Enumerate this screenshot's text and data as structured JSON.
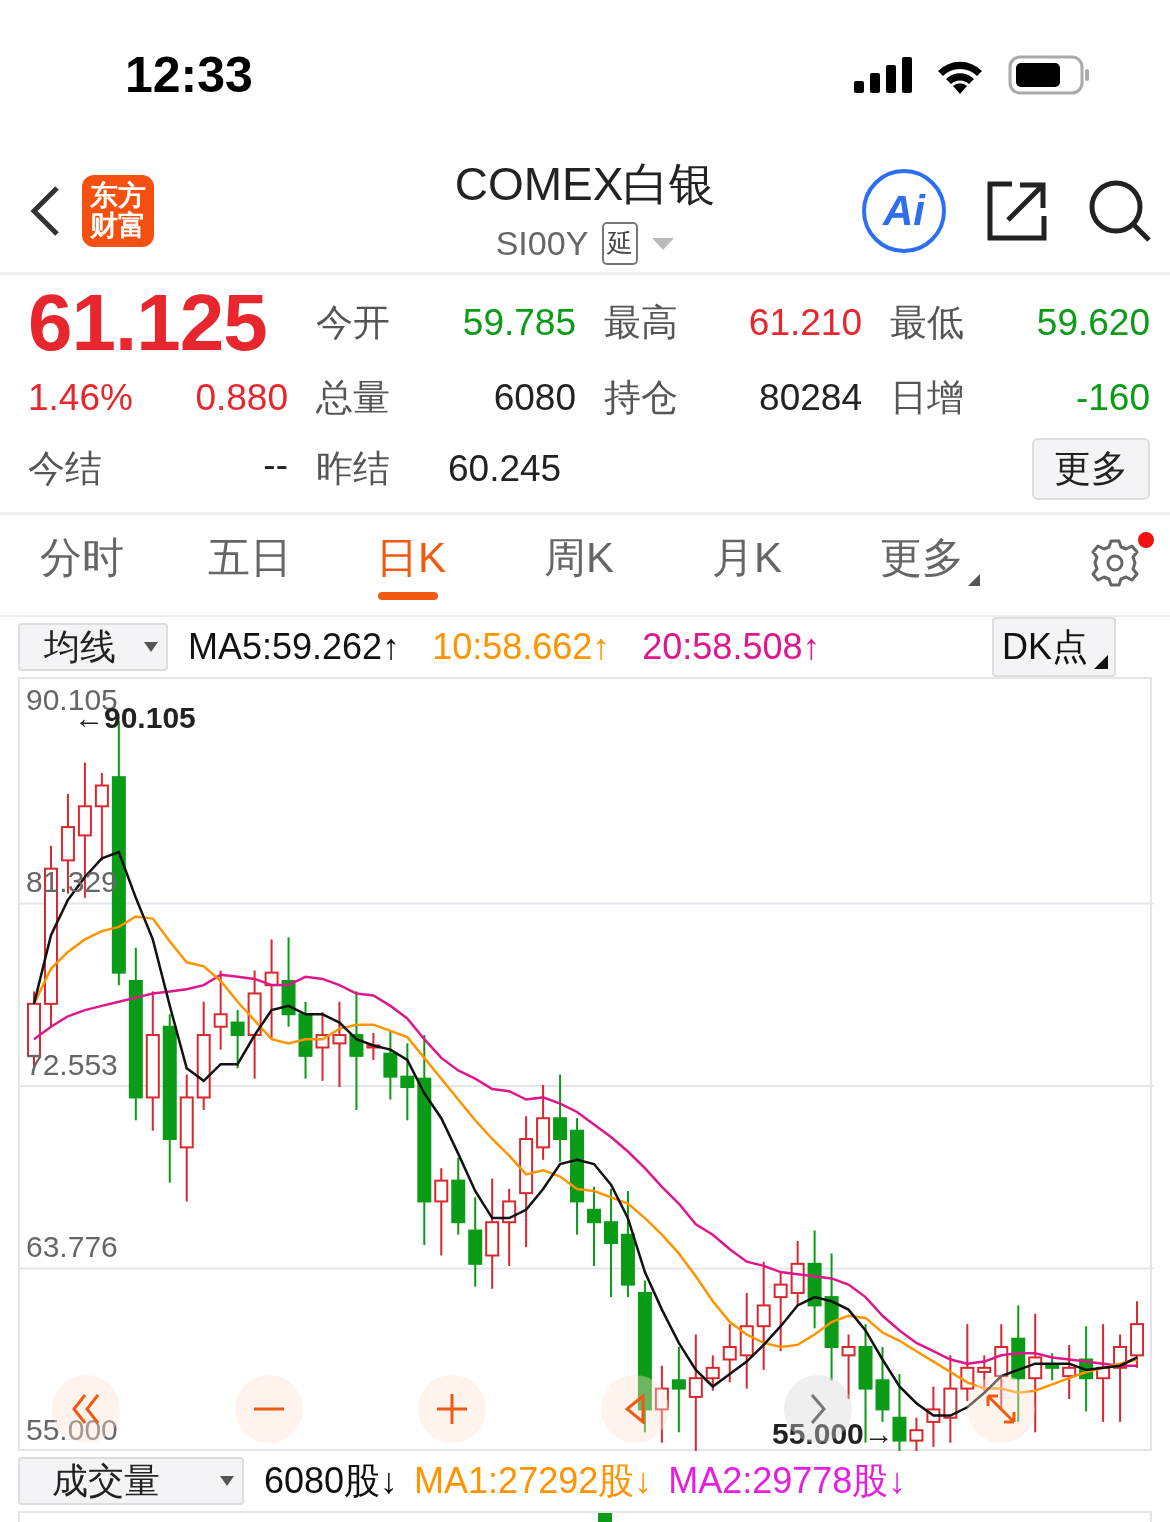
{
  "status_bar": {
    "time": "12:33"
  },
  "header": {
    "logo": "东方财富",
    "title": "COMEX白银",
    "code": "SI00Y",
    "tag": "延",
    "ai": "Ai"
  },
  "quote": {
    "price": "61.125",
    "change_pct": "1.46%",
    "change": "0.880",
    "settle_label": "今结",
    "settle_value": "--",
    "fields": [
      {
        "label": "今开",
        "value": "59.785",
        "color": "#0a9b17"
      },
      {
        "label": "最高",
        "value": "61.210",
        "color": "#e8262d"
      },
      {
        "label": "最低",
        "value": "59.620",
        "color": "#0a9b17"
      },
      {
        "label": "总量",
        "value": "6080",
        "color": "#222222"
      },
      {
        "label": "持仓",
        "value": "80284",
        "color": "#222222"
      },
      {
        "label": "日增",
        "value": "-160",
        "color": "#0a9b17"
      },
      {
        "label": "昨结",
        "value": "60.245",
        "color": "#222222"
      }
    ],
    "more": "更多"
  },
  "tabs": [
    {
      "label": "分时",
      "selected": false,
      "dropdown": false
    },
    {
      "label": "五日",
      "selected": false,
      "dropdown": false
    },
    {
      "label": "日K",
      "selected": true,
      "dropdown": false
    },
    {
      "label": "周K",
      "selected": false,
      "dropdown": false
    },
    {
      "label": "月K",
      "selected": false,
      "dropdown": false
    },
    {
      "label": "更多",
      "selected": false,
      "dropdown": true
    }
  ],
  "settings_badge": true,
  "ma_bar": {
    "selector": "均线",
    "items": [
      {
        "text": "MA5:59.262↑",
        "color": "#111111"
      },
      {
        "text": "10:58.662↑",
        "color": "#ff9400"
      },
      {
        "text": "20:58.508↑",
        "color": "#e0168c"
      }
    ],
    "dk": "DK点"
  },
  "chart": {
    "high_marker": "←90.105",
    "low_marker": "55.000→",
    "chart_data": {
      "type": "candlestick",
      "ylim": [
        55,
        92.12
      ],
      "grid": true,
      "yticks": [
        {
          "value": 90.105,
          "label": "90.105"
        },
        {
          "value": 81.329,
          "label": "81.329"
        },
        {
          "value": 72.553,
          "label": "72.553"
        },
        {
          "value": 63.776,
          "label": "63.776"
        },
        {
          "value": 55,
          "label": "55.000"
        }
      ],
      "ohlc": [
        [
          74,
          77.1,
          73.4,
          76.5
        ],
        [
          76.5,
          84.1,
          75.4,
          83
        ],
        [
          83.4,
          86.6,
          81.8,
          85
        ],
        [
          84.6,
          88.1,
          81.6,
          86
        ],
        [
          86,
          87.6,
          83.4,
          87
        ],
        [
          87.4,
          90.1,
          77.4,
          78
        ],
        [
          77.6,
          79.2,
          70.9,
          72
        ],
        [
          72,
          77.1,
          70.4,
          75
        ],
        [
          75.4,
          76,
          67.9,
          70
        ],
        [
          69.6,
          73.1,
          67,
          72
        ],
        [
          72,
          76.6,
          71.4,
          75
        ],
        [
          75.4,
          78.1,
          74.3,
          76
        ],
        [
          75.6,
          76.2,
          73.4,
          75
        ],
        [
          75,
          78.1,
          72.9,
          77
        ],
        [
          77.4,
          79.6,
          74.8,
          78
        ],
        [
          77.6,
          79.7,
          75.4,
          76
        ],
        [
          76,
          76.6,
          72.9,
          74
        ],
        [
          74.4,
          76.1,
          72.8,
          75
        ],
        [
          74.6,
          76.6,
          72.5,
          75
        ],
        [
          75,
          77.1,
          71.4,
          74
        ],
        [
          74.4,
          75.1,
          73.8,
          74.5
        ],
        [
          74.1,
          75.2,
          71.9,
          73
        ],
        [
          73,
          74.6,
          70.9,
          72.5
        ],
        [
          72.9,
          75,
          64.9,
          67
        ],
        [
          67,
          68.6,
          64.4,
          68
        ],
        [
          68,
          69.1,
          65.4,
          66
        ],
        [
          65.6,
          67.2,
          62.9,
          64
        ],
        [
          64.4,
          68.1,
          62.8,
          66
        ],
        [
          66,
          67.6,
          63.9,
          67
        ],
        [
          67.4,
          71.1,
          64.8,
          70
        ],
        [
          69.6,
          72.6,
          69,
          71
        ],
        [
          71,
          73.1,
          68.9,
          70
        ],
        [
          70.4,
          71,
          65.4,
          67
        ],
        [
          66.6,
          67.7,
          63.9,
          66
        ],
        [
          66,
          67.6,
          62.4,
          65
        ],
        [
          65.4,
          67.5,
          62.4,
          63
        ],
        [
          62.6,
          63.2,
          55.9,
          57
        ],
        [
          57,
          59.1,
          55.4,
          58
        ],
        [
          58.4,
          60,
          55.9,
          58
        ],
        [
          57.6,
          60.6,
          55,
          58.5
        ],
        [
          58.5,
          59.6,
          57.9,
          59
        ],
        [
          59.4,
          61.1,
          58.3,
          60
        ],
        [
          59.6,
          62.6,
          58,
          61
        ],
        [
          61,
          64.1,
          58.9,
          62
        ],
        [
          62.4,
          63.6,
          59.8,
          63
        ],
        [
          62.6,
          65.1,
          62,
          64
        ],
        [
          64,
          65.6,
          60.9,
          62
        ],
        [
          62.4,
          64.5,
          58.4,
          60
        ],
        [
          59.6,
          60.6,
          57.5,
          60
        ],
        [
          60,
          61.1,
          55.4,
          58
        ],
        [
          58.4,
          60,
          56.4,
          57
        ],
        [
          56.6,
          58.7,
          55,
          55.5
        ],
        [
          55.5,
          56.6,
          55,
          56
        ],
        [
          56.4,
          58.1,
          55.2,
          57
        ],
        [
          56.6,
          59.6,
          55.4,
          58
        ],
        [
          58,
          61.1,
          57.4,
          59
        ],
        [
          58.8,
          59.6,
          57.9,
          59
        ],
        [
          58.6,
          61.1,
          57,
          60
        ],
        [
          60.4,
          62,
          56.4,
          58.5
        ],
        [
          58.5,
          61.6,
          55.9,
          59.5
        ],
        [
          59.1,
          59.7,
          58.4,
          59
        ],
        [
          58.6,
          60.1,
          57.5,
          59
        ],
        [
          59.4,
          61,
          56.9,
          58.5
        ],
        [
          58.5,
          61.1,
          56.4,
          59
        ],
        [
          59,
          60.6,
          56.4,
          60
        ],
        [
          59.6,
          62.2,
          59,
          61.1
        ]
      ],
      "series": [
        {
          "type": "line",
          "color": "#111111",
          "values": [
            76.5,
            79.8,
            81.5,
            82.6,
            83.5,
            83.8,
            81.6,
            79.6,
            76.4,
            73.4,
            72.8,
            73.6,
            73.6,
            75,
            76.2,
            76.4,
            76,
            76,
            75.6,
            74.8,
            74.5,
            74.3,
            73.8,
            72.2,
            71,
            69.3,
            67.5,
            66.2,
            66.2,
            66.6,
            67.6,
            68.8,
            69,
            68.8,
            67.8,
            66.2,
            63.6,
            61.8,
            60.2,
            58.9,
            58.1,
            58.7,
            59.3,
            60.1,
            61,
            62,
            62.4,
            62.2,
            61.8,
            60.8,
            59.4,
            58.1,
            57.3,
            56.7,
            56.7,
            57.1,
            57.8,
            58.6,
            58.9,
            59.2,
            59.2,
            59.2,
            58.9,
            59,
            59.1,
            59.5
          ]
        },
        {
          "type": "line",
          "color": "#ff9400",
          "values": [
            76.5,
            78.2,
            79,
            79.6,
            80,
            80.2,
            80.7,
            80.6,
            79.5,
            78.5,
            78.3,
            77.6,
            76.6,
            75.7,
            74.8,
            74.6,
            74.8,
            74.8,
            75.3,
            75.5,
            75.5,
            75.2,
            74.9,
            73.9,
            72.9,
            71.9,
            70.9,
            70,
            69.2,
            68.3,
            68.5,
            68.2,
            67.6,
            67.5,
            67.2,
            66.9,
            66.2,
            65.4,
            64.5,
            63.4,
            62.2,
            61.2,
            60.6,
            60.2,
            60,
            60.1,
            60.6,
            61.2,
            61.5,
            61.4,
            60.7,
            60.3,
            59.8,
            59.3,
            58.8,
            58.3,
            58,
            58,
            57.8,
            57.9,
            58.2,
            58.5,
            58.8,
            59,
            59.2,
            59.4
          ]
        },
        {
          "type": "line",
          "color": "#e0168c",
          "values": [
            74.8,
            75.4,
            75.9,
            76.2,
            76.4,
            76.6,
            76.8,
            77,
            77.1,
            77.2,
            77.4,
            77.9,
            77.8,
            77.7,
            77.4,
            77.4,
            77.8,
            77.7,
            77.4,
            77,
            76.9,
            76.4,
            75.8,
            74.8,
            73.9,
            73.3,
            72.9,
            72.4,
            72.3,
            71.9,
            72,
            71.7,
            71.3,
            70.7,
            70.1,
            69.4,
            68.6,
            67.7,
            66.9,
            65.9,
            65.4,
            64.7,
            64.1,
            63.9,
            63.6,
            63.5,
            63.4,
            63.3,
            63,
            62.4,
            61.5,
            60.8,
            60.2,
            59.8,
            59.4,
            59.2,
            59.3,
            59.6,
            59.7,
            59.7,
            59.5,
            59.4,
            59.3,
            59.2,
            59.1,
            59.1
          ]
        }
      ]
    },
    "controls": [
      {
        "kind": "rewind",
        "disabled": false
      },
      {
        "kind": "zoom-out",
        "disabled": false
      },
      {
        "kind": "zoom-in",
        "disabled": false
      },
      {
        "kind": "back",
        "disabled": false
      },
      {
        "kind": "forward",
        "disabled": true
      },
      {
        "kind": "expand",
        "disabled": false
      }
    ]
  },
  "volume_bar": {
    "selector": "成交量",
    "items": [
      {
        "text": "6080股↓",
        "color": "#111111"
      },
      {
        "text": "MA1:27292股↓",
        "color": "#ff9400"
      },
      {
        "text": "MA2:29778股↓",
        "color": "#e61ee0"
      }
    ]
  }
}
